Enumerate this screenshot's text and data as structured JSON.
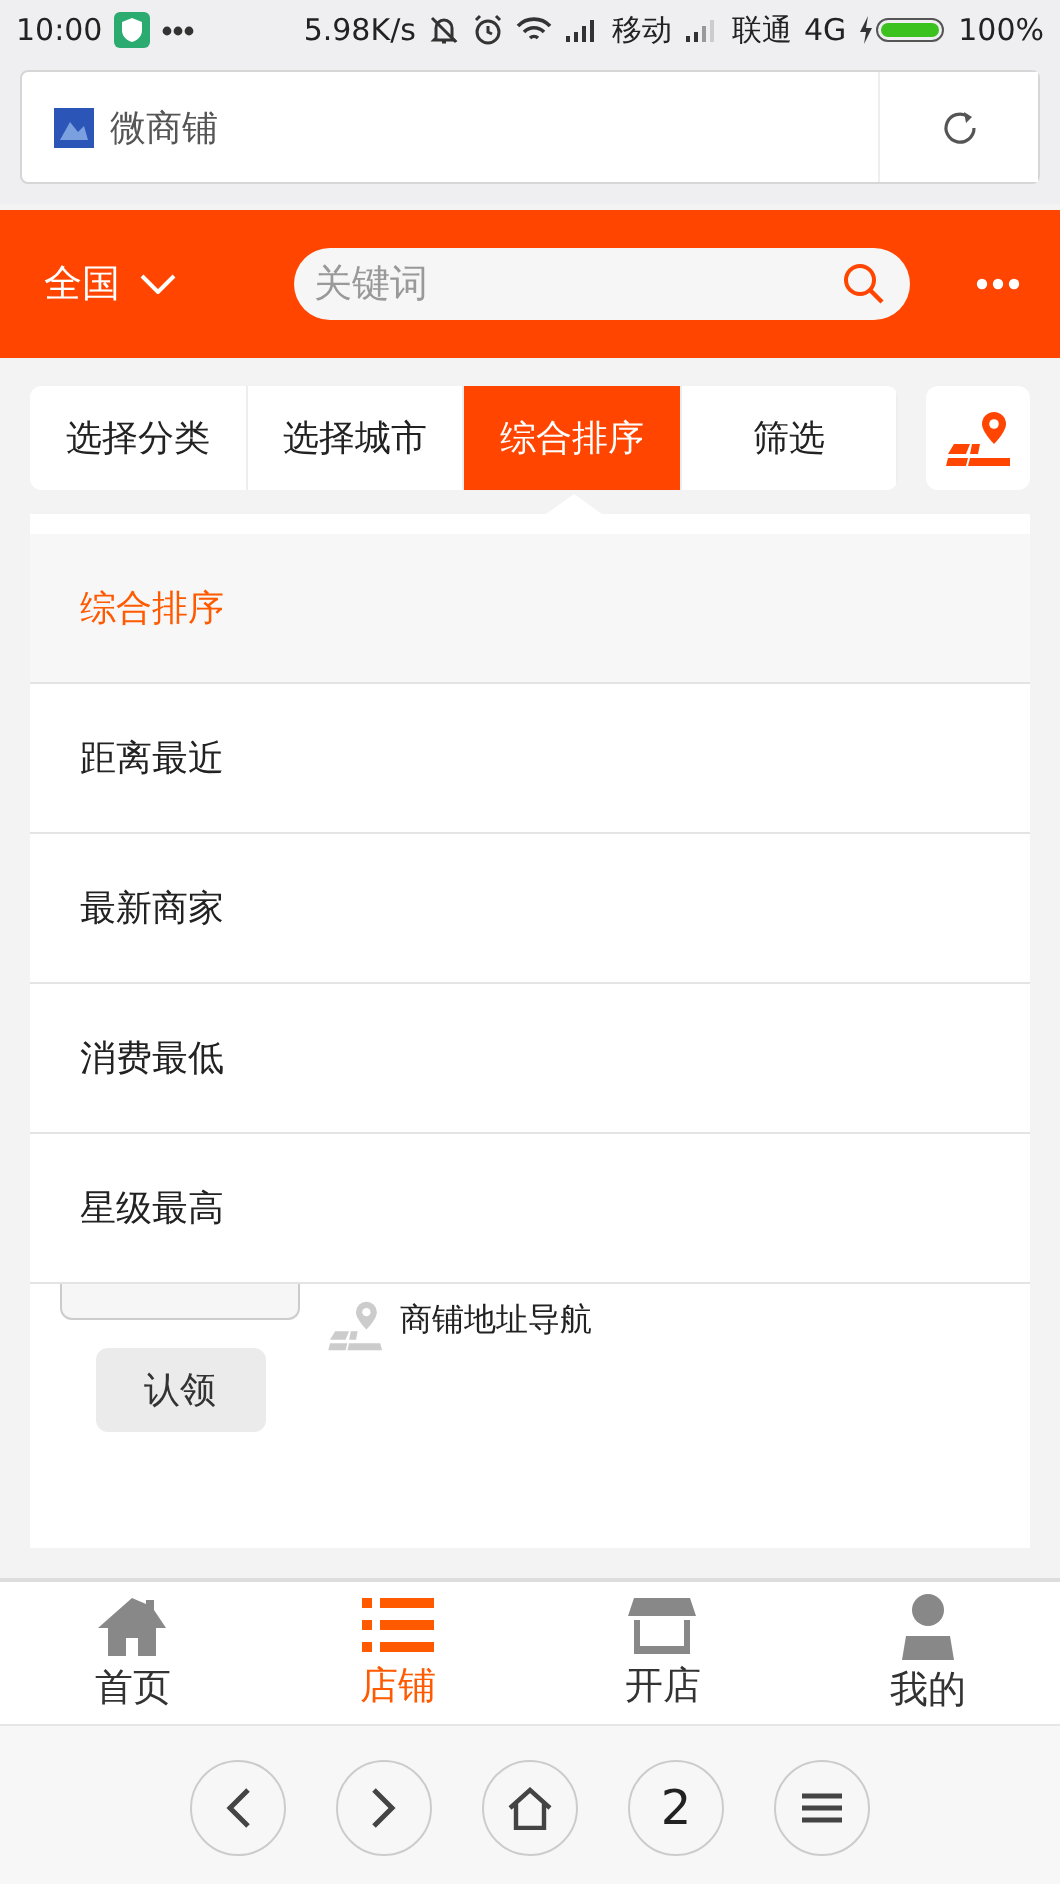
{
  "status_bar": {
    "time": "10:00",
    "speed": "5.98K/s",
    "carrier_1": "移动",
    "carrier_2": "联通",
    "network": "4G",
    "battery": "100%"
  },
  "address_bar": {
    "title": "微商铺"
  },
  "header": {
    "region": "全国",
    "search": {
      "placeholder": "关键词"
    }
  },
  "filter_tabs": [
    {
      "label": "选择分类",
      "selected": false
    },
    {
      "label": "选择城市",
      "selected": false
    },
    {
      "label": "综合排序",
      "selected": true
    },
    {
      "label": "筛选",
      "selected": false
    }
  ],
  "sort_menu": [
    {
      "label": "综合排序",
      "selected": true
    },
    {
      "label": "距离最近",
      "selected": false
    },
    {
      "label": "最新商家",
      "selected": false
    },
    {
      "label": "消费最低",
      "selected": false
    },
    {
      "label": "星级最高",
      "selected": false
    }
  ],
  "shop": {
    "nav_link": "商铺地址导航",
    "claim_button": "认领"
  },
  "bottom_nav": [
    {
      "label": "首页",
      "selected": false,
      "kind": "home"
    },
    {
      "label": "店铺",
      "selected": true,
      "kind": "list"
    },
    {
      "label": "开店",
      "selected": false,
      "kind": "store"
    },
    {
      "label": "我的",
      "selected": false,
      "kind": "user"
    }
  ],
  "browser_bar": {
    "tab_count": "2"
  }
}
